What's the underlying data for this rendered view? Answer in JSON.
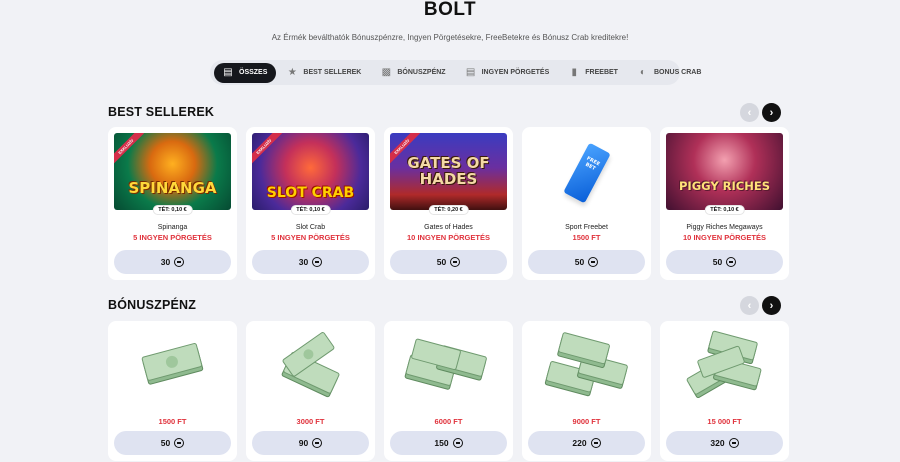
{
  "header": {
    "title": "BOLT",
    "subtitle": "Az Érmék beválthatók Bónuszpénzre, Ingyen Pörgetésekre, FreeBetekre és Bónusz Crab kreditekre!"
  },
  "filters": [
    {
      "label": "ÖSSZES",
      "icon": "bag-icon",
      "active": true
    },
    {
      "label": "BEST SELLEREK",
      "icon": "star-icon",
      "active": false
    },
    {
      "label": "BÓNUSZPÉNZ",
      "icon": "cash-icon",
      "active": false
    },
    {
      "label": "INGYEN PÖRGETÉS",
      "icon": "spin-icon",
      "active": false
    },
    {
      "label": "FREEBET",
      "icon": "ticket-icon",
      "active": false
    },
    {
      "label": "BONUS CRAB",
      "icon": "crab-icon",
      "active": false
    }
  ],
  "sections": {
    "best_sellers": {
      "title": "BEST SELLEREK",
      "items": [
        {
          "name": "Spinanga",
          "prize": "5 INGYEN PÖRGETÉS",
          "bet": "TÉT: 0,10 €",
          "price": "30",
          "art_text": "SPINANGA",
          "badge": "EXKLUZÍV"
        },
        {
          "name": "Slot Crab",
          "prize": "5 INGYEN PÖRGETÉS",
          "bet": "TÉT: 0,10 €",
          "price": "30",
          "art_text": "SLOT CRAB",
          "badge": "EXKLUZÍV"
        },
        {
          "name": "Gates of Hades",
          "prize": "10 INGYEN PÖRGETÉS",
          "bet": "TÉT: 0,20 €",
          "price": "50",
          "art_text": "GATES OF HADES",
          "badge": "EXKLUZÍV"
        },
        {
          "name": "Sport Freebet",
          "prize": "1500 FT",
          "bet": "",
          "price": "50",
          "art_text": "FREE BET",
          "badge": ""
        },
        {
          "name": "Piggy Riches Megaways",
          "prize": "10 INGYEN PÖRGETÉS",
          "bet": "TÉT: 0,10 €",
          "price": "50",
          "art_text": "PIGGY RICHES",
          "badge": ""
        }
      ]
    },
    "bonus_money": {
      "title": "BÓNUSZPÉNZ",
      "items": [
        {
          "prize": "1500 FT",
          "price": "50"
        },
        {
          "prize": "3000 FT",
          "price": "90"
        },
        {
          "prize": "6000 FT",
          "price": "150"
        },
        {
          "prize": "9000 FT",
          "price": "220"
        },
        {
          "prize": "15 000 FT",
          "price": "320"
        }
      ]
    }
  },
  "colors": {
    "accent_red": "#e0323c",
    "active_pill": "#15171c",
    "price_bar": "#dfe3f1",
    "background": "#f1f2f6"
  }
}
